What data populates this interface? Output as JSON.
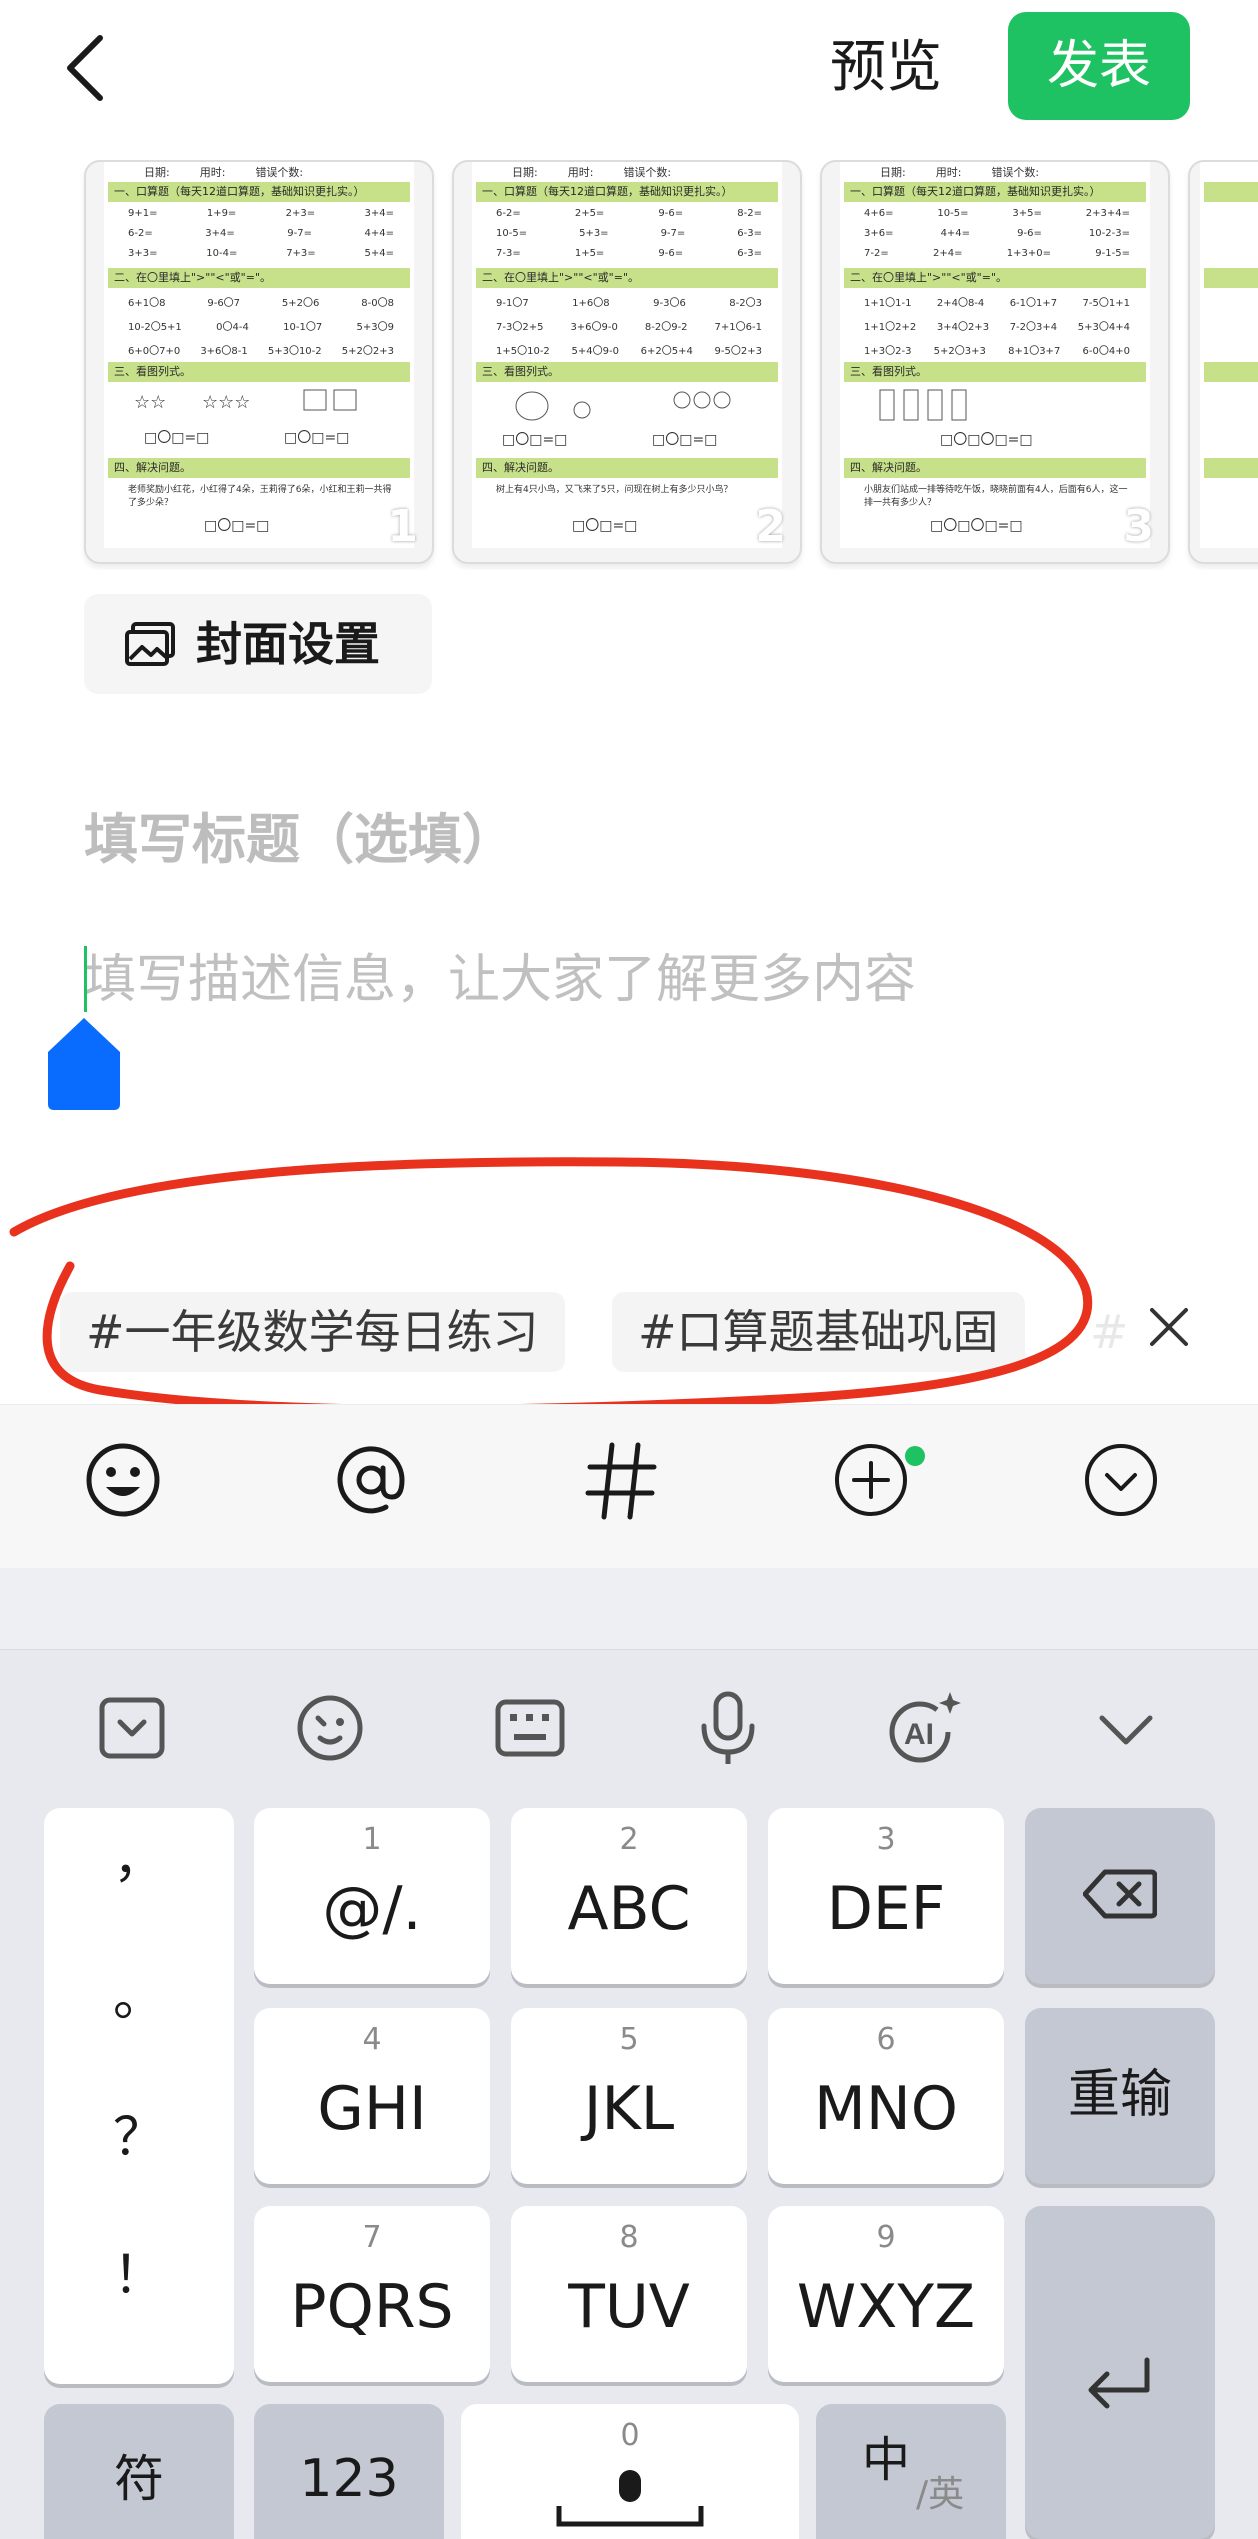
{
  "topbar": {
    "preview_label": "预览",
    "publish_label": "发表"
  },
  "thumbnails": [
    {
      "page": "1",
      "header": [
        "日期:",
        "用时:",
        "错误个数:"
      ],
      "section1": "一、口算题（每天12道口算题，基础知识更扎实。）",
      "rows1": [
        [
          "9+1=",
          "1+9=",
          "2+3=",
          "3+4="
        ],
        [
          "6-2=",
          "3+4=",
          "9-7=",
          "4+4="
        ],
        [
          "3+3=",
          "10-4=",
          "7+3=",
          "5+4="
        ]
      ],
      "section2": "二、在〇里填上\">\"\"<\"或\"=\"。",
      "rows2": [
        [
          "6+1〇8",
          "9-6〇7",
          "5+2〇6",
          "8-0〇8"
        ],
        [
          "10-2〇5+1",
          "0〇4-4",
          "10-1〇7",
          "5+3〇9"
        ],
        [
          "6+0〇7+0",
          "3+6〇8-1",
          "5+3〇10-2",
          "5+2〇2+3"
        ]
      ],
      "section3": "三、看图列式。",
      "section4": "四、解决问题。",
      "problem": "老师奖励小红花，小红得了4朵，王莉得了6朵，小红和王莉一共得了多少朵？"
    },
    {
      "page": "2",
      "header": [
        "日期:",
        "用时:",
        "错误个数:"
      ],
      "section1": "一、口算题（每天12道口算题，基础知识更扎实。）",
      "rows1": [
        [
          "6-2=",
          "2+5=",
          "9-6=",
          "8-2="
        ],
        [
          "10-5=",
          "5+3=",
          "9-7=",
          "6-3="
        ],
        [
          "7-3=",
          "1+5=",
          "9-6=",
          "6-3="
        ]
      ],
      "section2": "二、在〇里填上\">\"\"<\"或\"=\"。",
      "rows2": [
        [
          "9-1〇7",
          "1+6〇8",
          "9-3〇6",
          "8-2〇3"
        ],
        [
          "7-3〇2+5",
          "3+6〇9-0",
          "8-2〇9-2",
          "7+1〇6-1"
        ],
        [
          "1+5〇10-2",
          "5+4〇9-0",
          "6+2〇5+4",
          "9-5〇2+3"
        ]
      ],
      "section3": "三、看图列式。",
      "section4": "四、解决问题。",
      "problem": "树上有4只小鸟，又飞来了5只，问现在树上有多少只小鸟？"
    },
    {
      "page": "3",
      "header": [
        "日期:",
        "用时:",
        "错误个数:"
      ],
      "section1": "一、口算题（每天12道口算题，基础知识更扎实。）",
      "rows1": [
        [
          "4+6=",
          "10-5=",
          "3+5=",
          "2+3+4="
        ],
        [
          "3+6=",
          "4+4=",
          "9-6=",
          "10-2-3="
        ],
        [
          "7-2=",
          "2+4=",
          "1+3+0=",
          "9-1-5="
        ]
      ],
      "section2": "二、在〇里填上\">\"\"<\"或\"=\"。",
      "rows2": [
        [
          "1+1〇1-1",
          "2+4〇8-4",
          "6-1〇1+7",
          "7-5〇1+1"
        ],
        [
          "1+1〇2+2",
          "3+4〇2+3",
          "7-2〇3+4",
          "5+3〇4+4"
        ],
        [
          "1+3〇2-3",
          "5+2〇3+3",
          "8+1〇3+7",
          "6-0〇4+0"
        ]
      ],
      "section3": "三、看图列式。",
      "section4": "四、解决问题。",
      "problem": "小朋友们站成一排等待吃午饭，晓晓前面有4人，后面有6人，这一排一共有多少人？"
    }
  ],
  "cover": {
    "label": "封面设置",
    "icon": "image-icon"
  },
  "form": {
    "title_placeholder": "填写标题（选填）",
    "description_placeholder": "填写描述信息，让大家了解更多内容"
  },
  "topics": [
    "#一年级数学每日练习",
    "#口算题基础巩固"
  ],
  "topics_fade": "#",
  "toolbar": {
    "icons": [
      "emoji-icon",
      "at-icon",
      "hashtag-icon",
      "add-icon",
      "collapse-icon"
    ]
  },
  "keyboard": {
    "tools": [
      "keyboard-hide-icon",
      "sticker-icon",
      "keyboard-layout-icon",
      "microphone-icon",
      "ai-icon",
      "chevron-down-icon"
    ],
    "punctuation": [
      "，",
      "。",
      "？",
      "！"
    ],
    "keys": [
      {
        "num": "1",
        "letters": "@/."
      },
      {
        "num": "2",
        "letters": "ABC"
      },
      {
        "num": "3",
        "letters": "DEF"
      },
      {
        "num": "4",
        "letters": "GHI"
      },
      {
        "num": "5",
        "letters": "JKL"
      },
      {
        "num": "6",
        "letters": "MNO"
      },
      {
        "num": "7",
        "letters": "PQRS"
      },
      {
        "num": "8",
        "letters": "TUV"
      },
      {
        "num": "9",
        "letters": "WXYZ"
      }
    ],
    "reset_label": "重输",
    "symbol_label": "符",
    "num_label": "123",
    "space_num": "0",
    "lang_main": "中",
    "lang_alt": "/英"
  },
  "colors": {
    "accent": "#1fc262",
    "handle": "#0a6cff",
    "annotation": "#e8321e"
  }
}
